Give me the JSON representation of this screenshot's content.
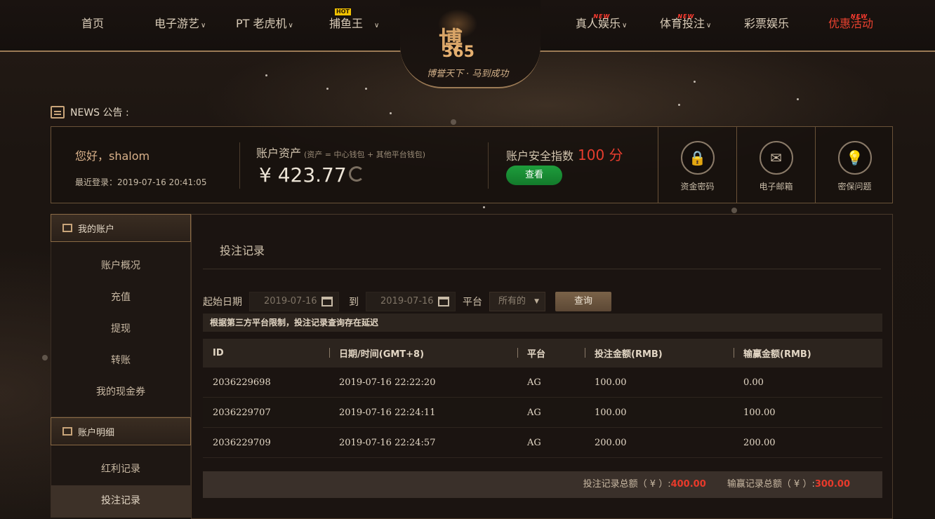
{
  "nav": {
    "home": "首页",
    "electronic": "电子游艺",
    "pt": "PT 老虎机",
    "fishing": "捕鱼王",
    "live": "真人娱乐",
    "sports": "体育投注",
    "lottery": "彩票娱乐",
    "promo": "优惠活动",
    "new_badge": "NEW",
    "hot_badge": "HOT"
  },
  "logo": {
    "main_text": "博",
    "number": "365",
    "slogan": "博誉天下 · 马到成功"
  },
  "news": {
    "label": "NEWS 公告 :"
  },
  "account": {
    "greeting": "您好，shalom",
    "last_login": "最近登录：2019-07-16 20:41:05",
    "asset_title": "账户资产",
    "asset_note": "(资产 = 中心钱包 + 其他平台钱包)",
    "asset_value": "¥ 423.77",
    "security_title": "账户安全指数",
    "security_score": "100 分",
    "view_button": "查看"
  },
  "tools": [
    {
      "label": "资金密码",
      "icon": "lock-icon"
    },
    {
      "label": "电子邮箱",
      "icon": "mail-icon"
    },
    {
      "label": "密保问题",
      "icon": "bulb-icon"
    }
  ],
  "sidebar": {
    "section1": "我的账户",
    "items1": [
      "账户概况",
      "充值",
      "提现",
      "转账",
      "我的现金券"
    ],
    "section2": "账户明细",
    "items2": [
      "红利记录",
      "投注记录"
    ]
  },
  "main": {
    "title": "投注记录",
    "start_label": "起始日期",
    "start_date": "2019-07-16",
    "to_label": "到",
    "end_date": "2019-07-16",
    "platform_label": "平台",
    "platform_value": "所有的",
    "query_button": "查询",
    "notice": "根据第三方平台限制，投注记录查询存在延迟",
    "columns": [
      "ID",
      "日期/时间(GMT+8)",
      "平台",
      "投注金额(RMB)",
      "输赢金额(RMB)"
    ],
    "rows": [
      [
        "2036229698",
        "2019-07-16 22:22:20",
        "AG",
        "100.00",
        "0.00"
      ],
      [
        "2036229707",
        "2019-07-16 22:24:11",
        "AG",
        "100.00",
        "100.00"
      ],
      [
        "2036229709",
        "2019-07-16 22:24:57",
        "AG",
        "200.00",
        "200.00"
      ]
    ],
    "total_bet_label": "投注记录总额（ ¥ ）:",
    "total_bet_value": "400.00",
    "total_win_label": "输赢记录总额（ ¥ ）:",
    "total_win_value": "300.00"
  }
}
